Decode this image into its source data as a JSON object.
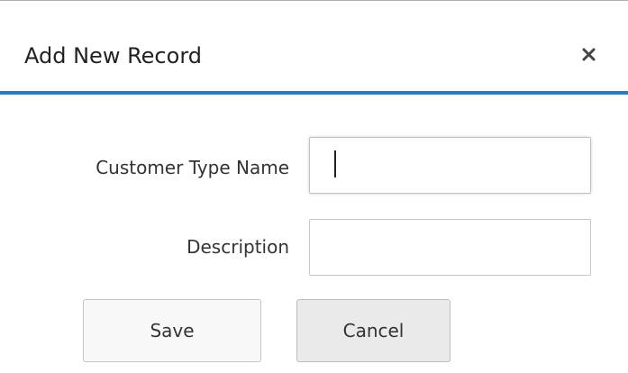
{
  "dialog": {
    "title": "Add New Record",
    "close_icon": "close-icon"
  },
  "form": {
    "customer_type_name": {
      "label": "Customer Type Name",
      "value": ""
    },
    "description": {
      "label": "Description",
      "value": ""
    }
  },
  "buttons": {
    "save_label": "Save",
    "cancel_label": "Cancel"
  },
  "colors": {
    "header_underline": "#3178b5",
    "text": "#333333"
  }
}
